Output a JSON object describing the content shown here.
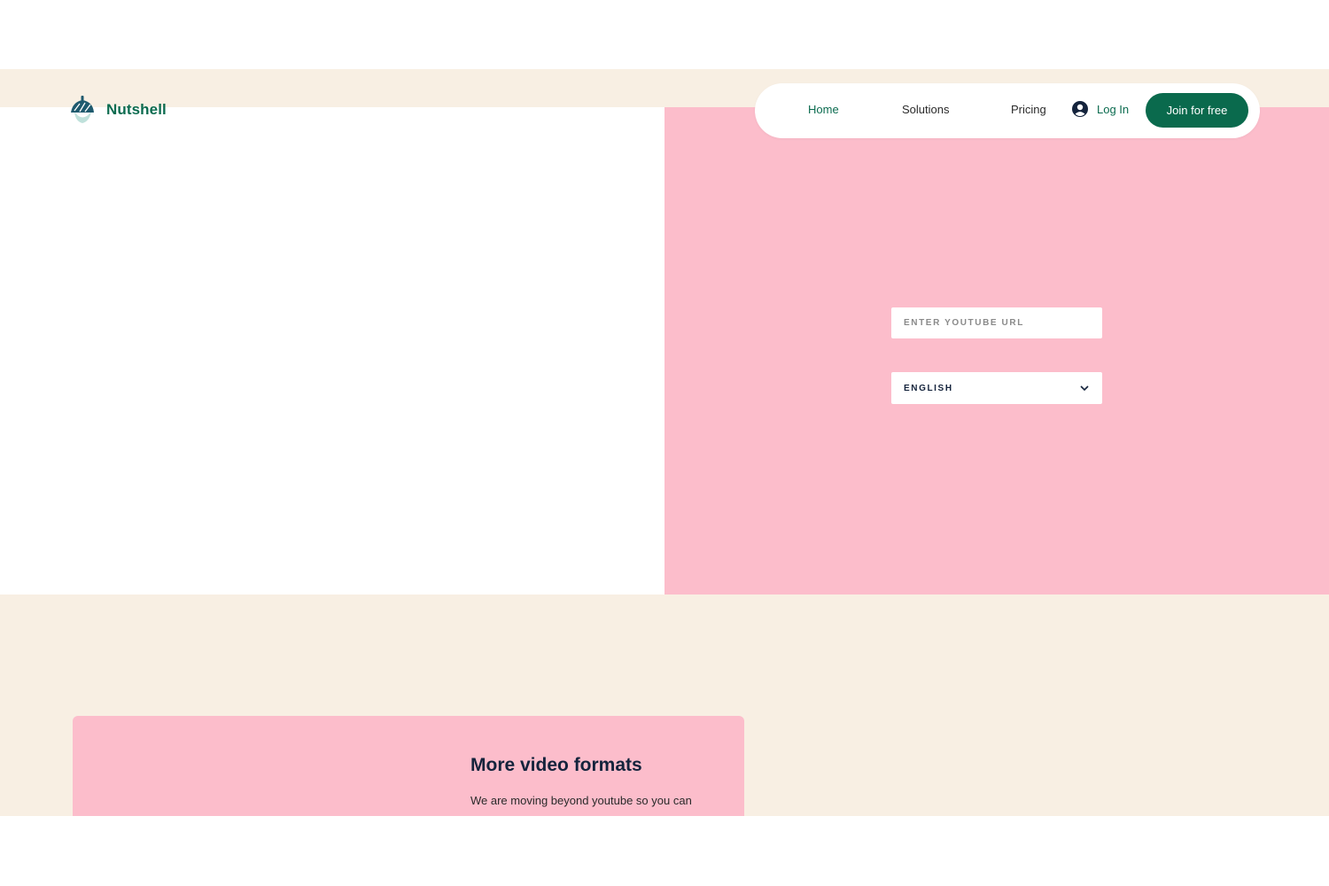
{
  "brand": {
    "name": "Nutshell",
    "color": "#0b6b4f",
    "logo_icon": "acorn-icon"
  },
  "nav": {
    "items": [
      {
        "label": "Home",
        "active": true
      },
      {
        "label": "Solutions",
        "active": false
      },
      {
        "label": "Pricing",
        "active": false
      }
    ],
    "login_label": "Log In",
    "login_icon": "user-avatar-icon",
    "join_label": "Join for free"
  },
  "hero": {
    "url_placeholder": "ENTER YOUTUBE URL",
    "url_value": "",
    "language_value": "ENGLISH",
    "language_icon": "chevron-down-icon",
    "accent_color": "#fcbdcb"
  },
  "feature": {
    "title": "More video formats",
    "description": "We are moving beyond youtube so you can"
  },
  "colors": {
    "cream": "#f8efe3",
    "pink": "#fcbdcb",
    "button_green": "#0a6a4d",
    "navy": "#14233c"
  }
}
